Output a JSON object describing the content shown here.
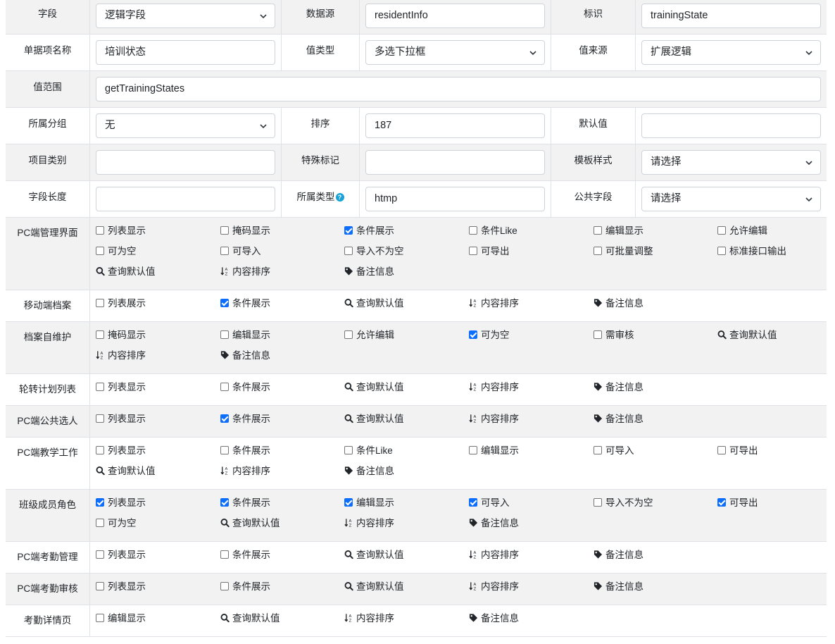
{
  "form": {
    "field_type": {
      "label": "字段",
      "value": "逻辑字段"
    },
    "datasource": {
      "label": "数据源",
      "value": "residentInfo"
    },
    "identifier": {
      "label": "标识",
      "value": "trainingState"
    },
    "item_name": {
      "label": "单据项名称",
      "value": "培训状态"
    },
    "value_type": {
      "label": "值类型",
      "value": "多选下拉框"
    },
    "value_source": {
      "label": "值来源",
      "value": "扩展逻辑"
    },
    "value_range": {
      "label": "值范围",
      "value": "getTrainingStates"
    },
    "group": {
      "label": "所属分组",
      "value": "无"
    },
    "sort": {
      "label": "排序",
      "value": "187"
    },
    "default_value": {
      "label": "默认值",
      "value": ""
    },
    "item_category": {
      "label": "项目类别",
      "value": ""
    },
    "special_mark": {
      "label": "特殊标记",
      "value": ""
    },
    "template_style": {
      "label": "模板样式",
      "value": "请选择"
    },
    "field_length": {
      "label": "字段长度",
      "value": ""
    },
    "belong_type": {
      "label": "所属类型",
      "value": "htmp",
      "help_icon": "question-circle-icon"
    },
    "public_field": {
      "label": "公共字段",
      "value": "请选择"
    }
  },
  "sections": [
    {
      "name": "PC端管理界面",
      "options": [
        {
          "type": "checkbox",
          "label": "列表显示",
          "checked": false
        },
        {
          "type": "checkbox",
          "label": "掩码显示",
          "checked": false
        },
        {
          "type": "checkbox",
          "label": "条件展示",
          "checked": true
        },
        {
          "type": "checkbox",
          "label": "条件Like",
          "checked": false
        },
        {
          "type": "checkbox",
          "label": "编辑显示",
          "checked": false
        },
        {
          "type": "checkbox",
          "label": "允许编辑",
          "checked": false
        },
        {
          "type": "checkbox",
          "label": "可为空",
          "checked": false
        },
        {
          "type": "checkbox",
          "label": "可导入",
          "checked": false
        },
        {
          "type": "checkbox",
          "label": "导入不为空",
          "checked": false
        },
        {
          "type": "checkbox",
          "label": "可导出",
          "checked": false
        },
        {
          "type": "checkbox",
          "label": "可批量调整",
          "checked": false
        },
        {
          "type": "checkbox",
          "label": "标准接口输出",
          "checked": false
        },
        {
          "type": "search",
          "label": "查询默认值",
          "icon": "search-icon"
        },
        {
          "type": "sort",
          "label": "内容排序",
          "icon": "sort-icon"
        },
        {
          "type": "tag",
          "label": "备注信息",
          "icon": "tag-icon"
        }
      ]
    },
    {
      "name": "移动端档案",
      "options": [
        {
          "type": "checkbox",
          "label": "列表展示",
          "checked": false
        },
        {
          "type": "checkbox",
          "label": "条件展示",
          "checked": true
        },
        {
          "type": "search",
          "label": "查询默认值",
          "icon": "search-icon"
        },
        {
          "type": "sort",
          "label": "内容排序",
          "icon": "sort-icon"
        },
        {
          "type": "tag",
          "label": "备注信息",
          "icon": "tag-icon"
        }
      ]
    },
    {
      "name": "档案自维护",
      "options": [
        {
          "type": "checkbox",
          "label": "掩码显示",
          "checked": false
        },
        {
          "type": "checkbox",
          "label": "编辑显示",
          "checked": false
        },
        {
          "type": "checkbox",
          "label": "允许编辑",
          "checked": false
        },
        {
          "type": "checkbox",
          "label": "可为空",
          "checked": true
        },
        {
          "type": "checkbox",
          "label": "需审核",
          "checked": false
        },
        {
          "type": "search",
          "label": "查询默认值",
          "icon": "search-icon"
        },
        {
          "type": "sort",
          "label": "内容排序",
          "icon": "sort-icon"
        },
        {
          "type": "tag",
          "label": "备注信息",
          "icon": "tag-icon"
        }
      ]
    },
    {
      "name": "轮转计划列表",
      "options": [
        {
          "type": "checkbox",
          "label": "列表显示",
          "checked": false
        },
        {
          "type": "checkbox",
          "label": "条件展示",
          "checked": false
        },
        {
          "type": "search",
          "label": "查询默认值",
          "icon": "search-icon"
        },
        {
          "type": "sort",
          "label": "内容排序",
          "icon": "sort-icon"
        },
        {
          "type": "tag",
          "label": "备注信息",
          "icon": "tag-icon"
        }
      ]
    },
    {
      "name": "PC端公共选人",
      "options": [
        {
          "type": "checkbox",
          "label": "列表显示",
          "checked": false
        },
        {
          "type": "checkbox",
          "label": "条件展示",
          "checked": true
        },
        {
          "type": "search",
          "label": "查询默认值",
          "icon": "search-icon"
        },
        {
          "type": "sort",
          "label": "内容排序",
          "icon": "sort-icon"
        },
        {
          "type": "tag",
          "label": "备注信息",
          "icon": "tag-icon"
        }
      ]
    },
    {
      "name": "PC端教学工作",
      "options": [
        {
          "type": "checkbox",
          "label": "列表显示",
          "checked": false
        },
        {
          "type": "checkbox",
          "label": "条件展示",
          "checked": false
        },
        {
          "type": "checkbox",
          "label": "条件Like",
          "checked": false
        },
        {
          "type": "checkbox",
          "label": "编辑显示",
          "checked": false
        },
        {
          "type": "checkbox",
          "label": "可导入",
          "checked": false
        },
        {
          "type": "checkbox",
          "label": "可导出",
          "checked": false
        },
        {
          "type": "search",
          "label": "查询默认值",
          "icon": "search-icon"
        },
        {
          "type": "sort",
          "label": "内容排序",
          "icon": "sort-icon"
        },
        {
          "type": "tag",
          "label": "备注信息",
          "icon": "tag-icon"
        }
      ]
    },
    {
      "name": "班级成员角色",
      "options": [
        {
          "type": "checkbox",
          "label": "列表显示",
          "checked": true
        },
        {
          "type": "checkbox",
          "label": "条件展示",
          "checked": true
        },
        {
          "type": "checkbox",
          "label": "编辑显示",
          "checked": true
        },
        {
          "type": "checkbox",
          "label": "可导入",
          "checked": true
        },
        {
          "type": "checkbox",
          "label": "导入不为空",
          "checked": false
        },
        {
          "type": "checkbox",
          "label": "可导出",
          "checked": true
        },
        {
          "type": "checkbox",
          "label": "可为空",
          "checked": false
        },
        {
          "type": "search",
          "label": "查询默认值",
          "icon": "search-icon"
        },
        {
          "type": "sort",
          "label": "内容排序",
          "icon": "sort-icon"
        },
        {
          "type": "tag",
          "label": "备注信息",
          "icon": "tag-icon"
        }
      ]
    },
    {
      "name": "PC端考勤管理",
      "options": [
        {
          "type": "checkbox",
          "label": "列表显示",
          "checked": false
        },
        {
          "type": "checkbox",
          "label": "条件展示",
          "checked": false
        },
        {
          "type": "search",
          "label": "查询默认值",
          "icon": "search-icon"
        },
        {
          "type": "sort",
          "label": "内容排序",
          "icon": "sort-icon"
        },
        {
          "type": "tag",
          "label": "备注信息",
          "icon": "tag-icon"
        }
      ]
    },
    {
      "name": "PC端考勤审核",
      "options": [
        {
          "type": "checkbox",
          "label": "列表显示",
          "checked": false
        },
        {
          "type": "checkbox",
          "label": "条件展示",
          "checked": false
        },
        {
          "type": "search",
          "label": "查询默认值",
          "icon": "search-icon"
        },
        {
          "type": "sort",
          "label": "内容排序",
          "icon": "sort-icon"
        },
        {
          "type": "tag",
          "label": "备注信息",
          "icon": "tag-icon"
        }
      ]
    },
    {
      "name": "考勤详情页",
      "options": [
        {
          "type": "checkbox",
          "label": "编辑显示",
          "checked": false
        },
        {
          "type": "search",
          "label": "查询默认值",
          "icon": "search-icon"
        },
        {
          "type": "sort",
          "label": "内容排序",
          "icon": "sort-icon"
        },
        {
          "type": "tag",
          "label": "备注信息",
          "icon": "tag-icon"
        }
      ]
    }
  ]
}
